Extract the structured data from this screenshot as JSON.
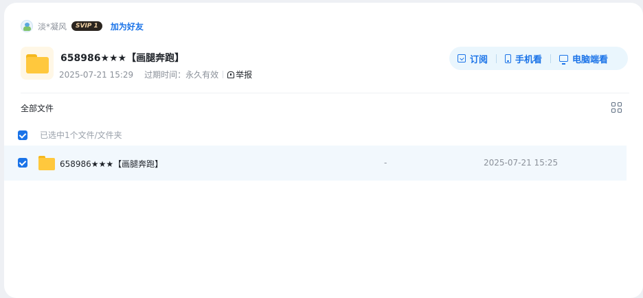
{
  "owner": {
    "name": "淡*凝风",
    "vip_badge": "SVIP 1",
    "add_friend_label": "加为好友"
  },
  "share": {
    "title": "658986★★★【画腿奔跑】",
    "created": "2025-07-21 15:29",
    "expiry_label": "过期时间：",
    "expiry_value": "永久有效",
    "report_label": "举报"
  },
  "actions": {
    "subscribe_label": "订阅",
    "mobile_label": "手机看",
    "pc_label": "电脑端看"
  },
  "list": {
    "header_label": "全部文件",
    "selection_text": "已选中1个文件/文件夹",
    "rows": [
      {
        "name": "658986★★★【画腿奔跑】",
        "size": "-",
        "time": "2025-07-21 15:25",
        "selected": true
      }
    ]
  },
  "colors": {
    "accent": "#1a73e8",
    "folder": "#ffc83d",
    "row_highlight": "#f2f8fd"
  },
  "icons": [
    "avatar",
    "folder-icon",
    "report-icon",
    "subscribe-icon",
    "phone-icon",
    "monitor-icon",
    "grid-view-icon",
    "checkbox-checked-icon"
  ]
}
